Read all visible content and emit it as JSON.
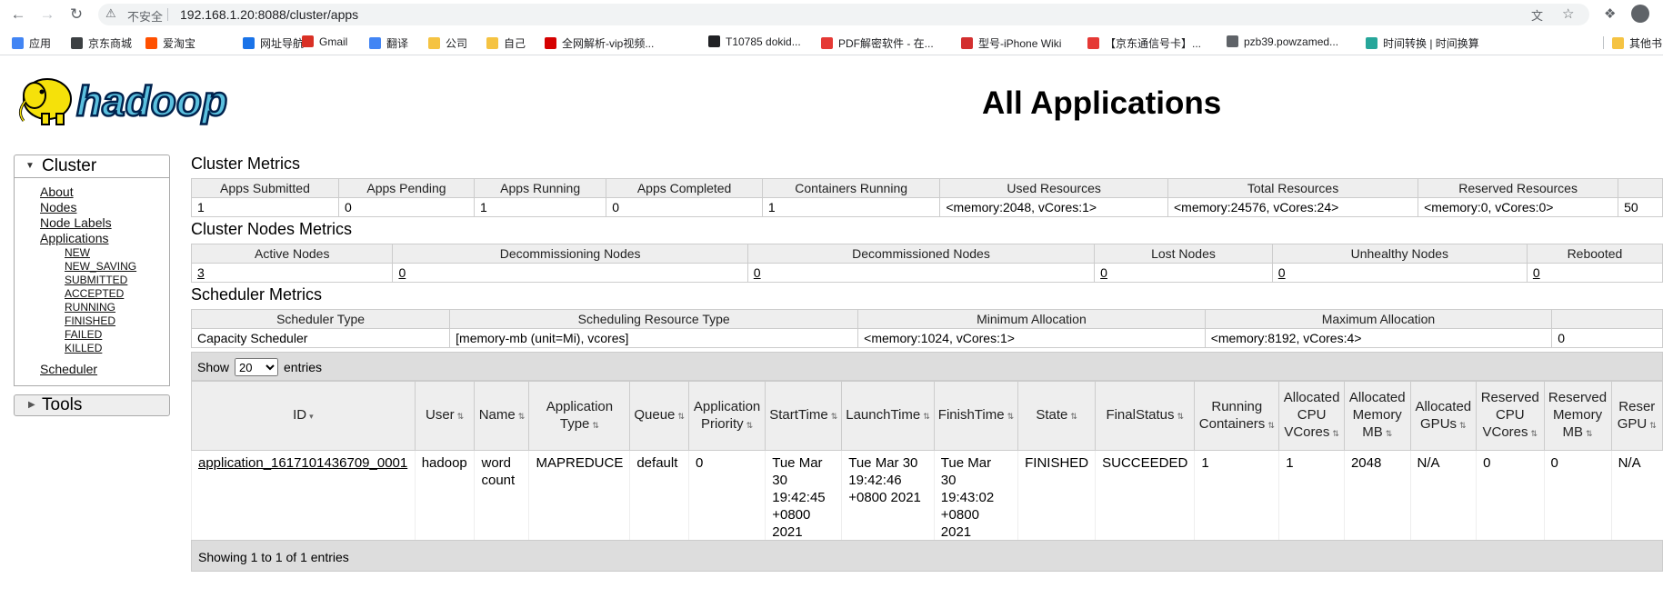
{
  "browser": {
    "security_label": "不安全",
    "url": "192.168.1.20:8088/cluster/apps",
    "bookmarks": [
      {
        "label": "应用",
        "color": "#4285f4"
      },
      {
        "label": "京东商城",
        "color": "#3c4043"
      },
      {
        "label": "爱淘宝",
        "color": "#ff5000"
      },
      {
        "label": "网址导航",
        "color": "#1a73e8"
      },
      {
        "label": "Gmail",
        "color": "#d93025"
      },
      {
        "label": "翻译",
        "color": "#4285f4"
      },
      {
        "label": "公司",
        "color": "#f5c342"
      },
      {
        "label": "自己",
        "color": "#f5c342"
      },
      {
        "label": "全网解析-vip视频...",
        "color": "#d50000"
      },
      {
        "label": "T10785 dokid...",
        "color": "#202124"
      },
      {
        "label": "PDF解密软件 - 在...",
        "color": "#e53935"
      },
      {
        "label": "型号-iPhone Wiki",
        "color": "#d32f2f"
      },
      {
        "label": "【京东通信号卡】...",
        "color": "#e53935"
      },
      {
        "label": "pzb39.powzamed...",
        "color": "#5f6368"
      },
      {
        "label": "时间转换 | 时间换算",
        "color": "#26a69a"
      },
      {
        "label": "其他书",
        "color": "#f5c342"
      }
    ]
  },
  "page": {
    "logo_text": "hadoop",
    "title": "All Applications"
  },
  "sidebar": {
    "cluster_label": "Cluster",
    "links": [
      "About",
      "Nodes",
      "Node Labels",
      "Applications"
    ],
    "app_states": [
      "NEW",
      "NEW_SAVING",
      "SUBMITTED",
      "ACCEPTED",
      "RUNNING",
      "FINISHED",
      "FAILED",
      "KILLED"
    ],
    "scheduler_label": "Scheduler",
    "tools_label": "Tools"
  },
  "cluster_metrics": {
    "title": "Cluster Metrics",
    "headers": [
      "Apps Submitted",
      "Apps Pending",
      "Apps Running",
      "Apps Completed",
      "Containers Running",
      "Used Resources",
      "Total Resources",
      "Reserved Resources",
      ""
    ],
    "values": [
      "1",
      "0",
      "1",
      "0",
      "1",
      "<memory:2048, vCores:1>",
      "<memory:24576, vCores:24>",
      "<memory:0, vCores:0>",
      "50"
    ]
  },
  "nodes_metrics": {
    "title": "Cluster Nodes Metrics",
    "headers": [
      "Active Nodes",
      "Decommissioning Nodes",
      "Decommissioned Nodes",
      "Lost Nodes",
      "Unhealthy Nodes",
      "Rebooted"
    ],
    "values": [
      "3",
      "0",
      "0",
      "0",
      "0",
      "0"
    ]
  },
  "scheduler_metrics": {
    "title": "Scheduler Metrics",
    "headers": [
      "Scheduler Type",
      "Scheduling Resource Type",
      "Minimum Allocation",
      "Maximum Allocation",
      ""
    ],
    "values": [
      "Capacity Scheduler",
      "[memory-mb (unit=Mi), vcores]",
      "<memory:1024, vCores:1>",
      "<memory:8192, vCores:4>",
      "0"
    ]
  },
  "apps_table": {
    "show_label": "Show",
    "entries_label": "entries",
    "page_size": "20",
    "page_size_options": [
      "20"
    ],
    "headers": [
      [
        "ID"
      ],
      [
        "User"
      ],
      [
        "Name"
      ],
      [
        "Application",
        "Type"
      ],
      [
        "Queue"
      ],
      [
        "Application",
        "Priority"
      ],
      [
        "StartTime"
      ],
      [
        "LaunchTime"
      ],
      [
        "FinishTime"
      ],
      [
        "State"
      ],
      [
        "FinalStatus"
      ],
      [
        "Running",
        "Containers"
      ],
      [
        "Allocated",
        "CPU",
        "VCores"
      ],
      [
        "Allocated",
        "Memory",
        "MB"
      ],
      [
        "Allocated",
        "GPUs"
      ],
      [
        "Reserved",
        "CPU",
        "VCores"
      ],
      [
        "Reserved",
        "Memory",
        "MB"
      ],
      [
        "Reser",
        "GPU"
      ]
    ],
    "rows": [
      [
        [
          "application_1617101436709_0001"
        ],
        [
          "hadoop"
        ],
        [
          "word",
          "count"
        ],
        [
          "MAPREDUCE"
        ],
        [
          "default"
        ],
        [
          "0"
        ],
        [
          "Tue Mar",
          "30",
          "19:42:45",
          "+0800",
          "2021"
        ],
        [
          "Tue Mar 30",
          "19:42:46",
          "+0800 2021"
        ],
        [
          "Tue Mar",
          "30",
          "19:43:02",
          "+0800",
          "2021"
        ],
        [
          "FINISHED"
        ],
        [
          "SUCCEEDED"
        ],
        [
          "1"
        ],
        [
          "1"
        ],
        [
          "2048"
        ],
        [
          "N/A"
        ],
        [
          "0"
        ],
        [
          "0"
        ],
        [
          "N/A"
        ]
      ]
    ],
    "footer": "Showing 1 to 1 of 1 entries"
  }
}
